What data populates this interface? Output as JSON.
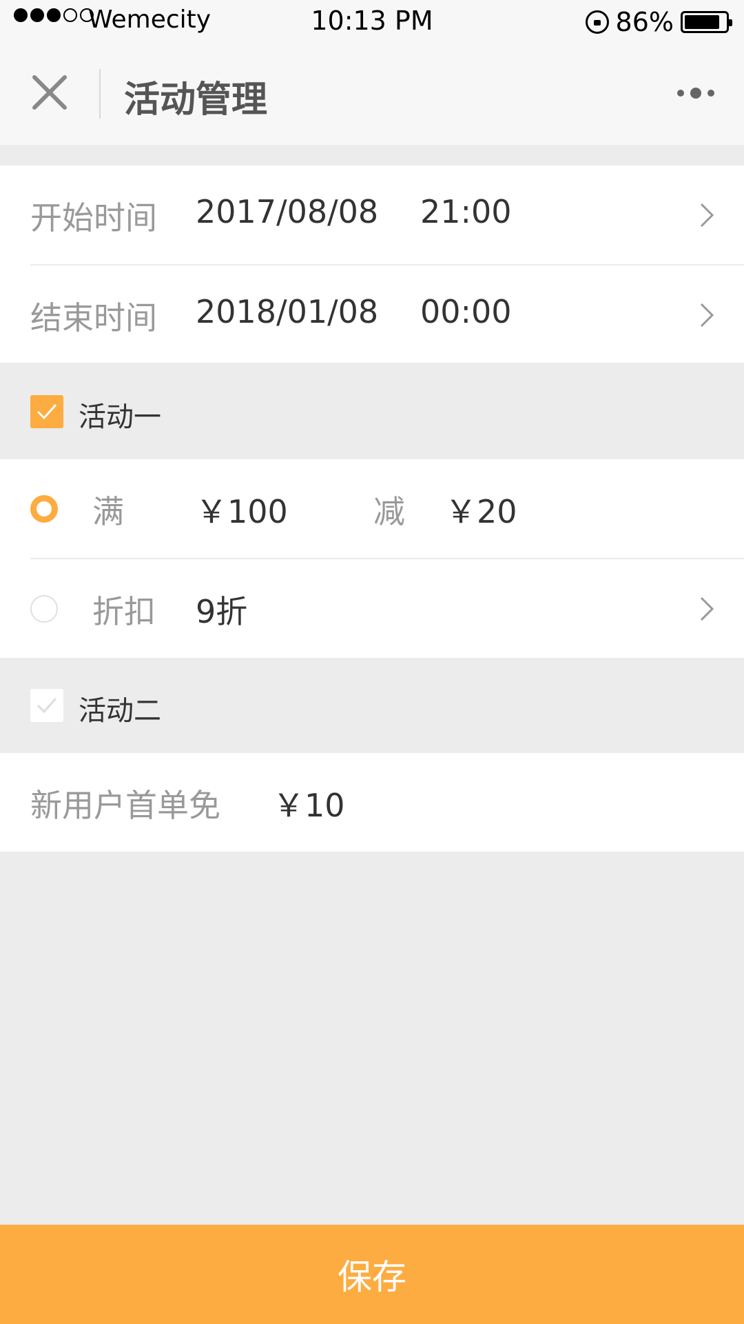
{
  "status_bar": {
    "carrier": "Wemecity",
    "time": "10:13 PM",
    "battery_percent": "86%",
    "battery_level": 0.86
  },
  "nav": {
    "title": "活动管理"
  },
  "time_section": {
    "start_label": "开始时间",
    "start_date": "2017/08/08",
    "start_time": "21:00",
    "end_label": "结束时间",
    "end_date": "2018/01/08",
    "end_time": "00:00"
  },
  "activity_one": {
    "label": "活动一",
    "checked": true,
    "full_label": "满",
    "full_amount": "￥100",
    "reduce_label": "减",
    "reduce_amount": "￥20",
    "discount_label": "折扣",
    "discount_value": "9折"
  },
  "activity_two": {
    "label": "活动二",
    "checked": false,
    "new_user_label": "新用户首单免",
    "new_user_amount": "￥10"
  },
  "footer": {
    "save_label": "保存"
  },
  "colors": {
    "accent": "#fdac41",
    "background": "#ececec",
    "label_gray": "#999999"
  }
}
